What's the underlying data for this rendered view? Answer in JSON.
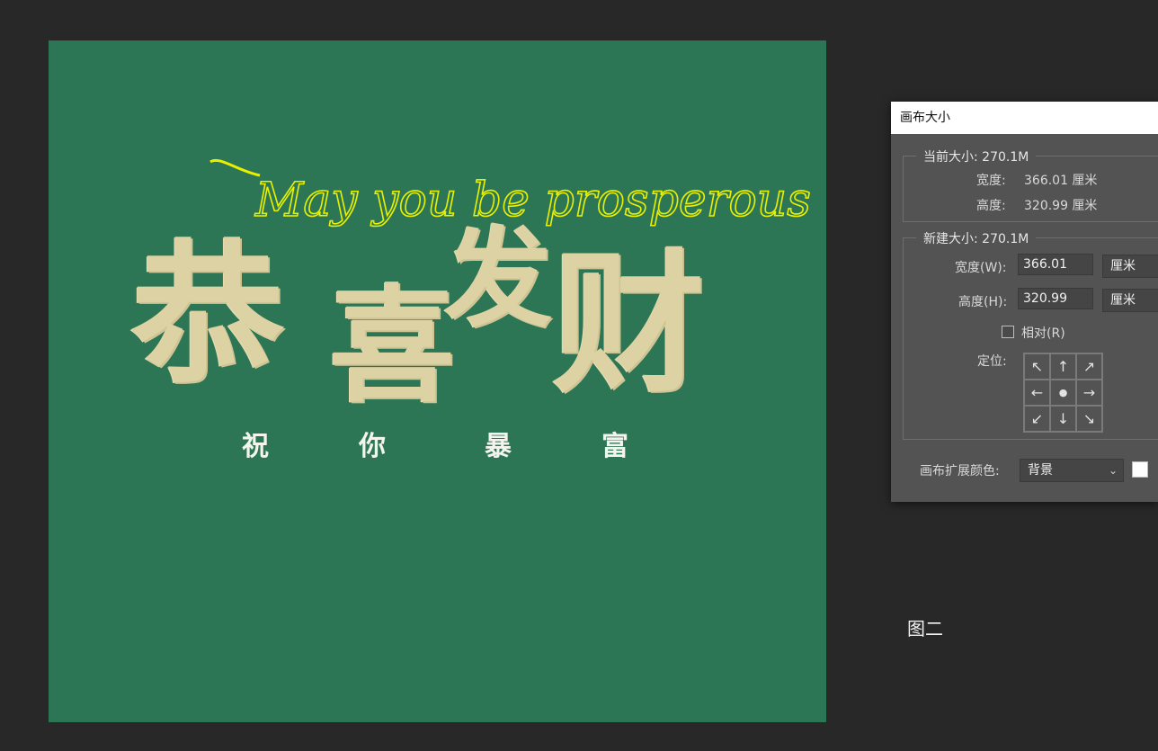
{
  "artwork": {
    "background_color": "#2c7655",
    "script_text": "May you be prosperous",
    "main_chars": [
      "恭",
      "喜",
      "发",
      "财"
    ],
    "sub_chars": [
      "祝",
      "你",
      "暴",
      "富"
    ]
  },
  "dialog": {
    "title": "画布大小",
    "current": {
      "group_label": "当前大小: 270.1M",
      "width_label": "宽度:",
      "width_value": "366.01 厘米",
      "height_label": "高度:",
      "height_value": "320.99 厘米"
    },
    "new": {
      "group_label": "新建大小: 270.1M",
      "width_label": "宽度(W):",
      "width_value": "366.01",
      "width_unit": "厘米",
      "height_label": "高度(H):",
      "height_value": "320.99",
      "height_unit": "厘米",
      "relative_label": "相对(R)",
      "relative_checked": false,
      "anchor_label": "定位:",
      "anchor_glyphs": [
        "↖",
        "↑",
        "↗",
        "←",
        "●",
        "→",
        "↙",
        "↓",
        "↘"
      ]
    },
    "extension_color_label": "画布扩展颜色:",
    "extension_color_value": "背景",
    "extension_swatch": "#ffffff"
  },
  "caption": "图二"
}
